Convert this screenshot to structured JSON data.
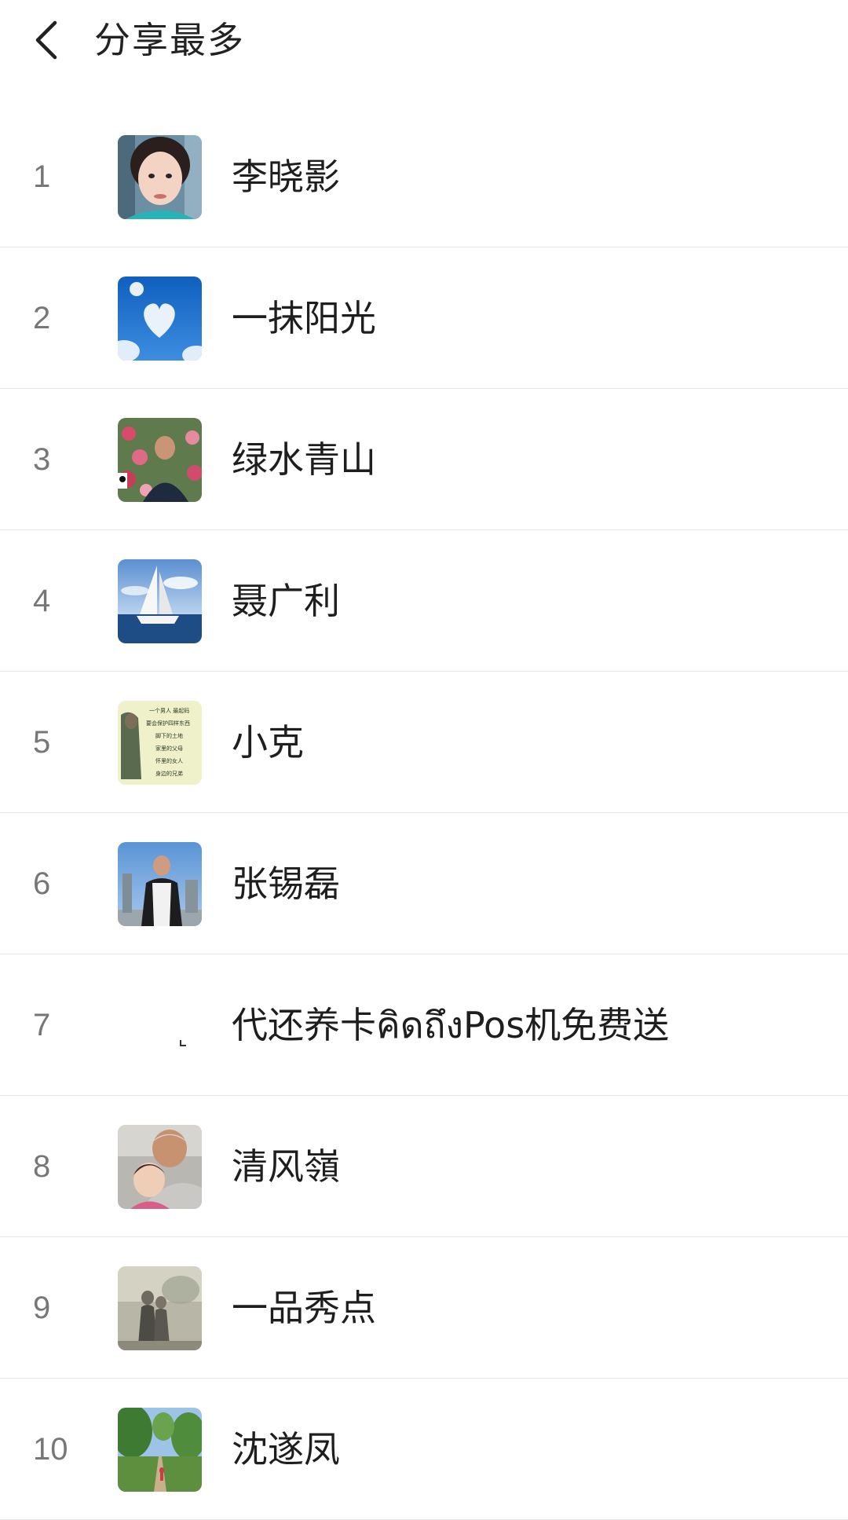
{
  "header": {
    "back_icon": "chevron-left-icon",
    "title": "分享最多"
  },
  "ranking": [
    {
      "rank": "1",
      "name": "李晓影",
      "avatar": "portrait-woman-avatar"
    },
    {
      "rank": "2",
      "name": "一抹阳光",
      "avatar": "heart-cloud-sky-avatar"
    },
    {
      "rank": "3",
      "name": "绿水青山",
      "avatar": "man-flowers-avatar"
    },
    {
      "rank": "4",
      "name": "聂广利",
      "avatar": "sailboat-avatar"
    },
    {
      "rank": "5",
      "name": "小克",
      "avatar": "text-poster-avatar"
    },
    {
      "rank": "6",
      "name": "张锡磊",
      "avatar": "man-outdoor-avatar"
    },
    {
      "rank": "7",
      "name": "代还养卡คิดถึงPos机免费送",
      "avatar": "blank-avatar"
    },
    {
      "rank": "8",
      "name": "清风嶺",
      "avatar": "grandpa-baby-avatar"
    },
    {
      "rank": "9",
      "name": "一品秀点",
      "avatar": "couple-photo-avatar"
    },
    {
      "rank": "10",
      "name": "沈遂凤",
      "avatar": "tree-path-avatar"
    }
  ],
  "avatar_text": {
    "poster_lines": [
      "一个男人 最起码",
      "要会保护四样东西",
      "脚下的土地",
      "家里的父母",
      "怀里的女人",
      "身边的兄弟"
    ]
  }
}
